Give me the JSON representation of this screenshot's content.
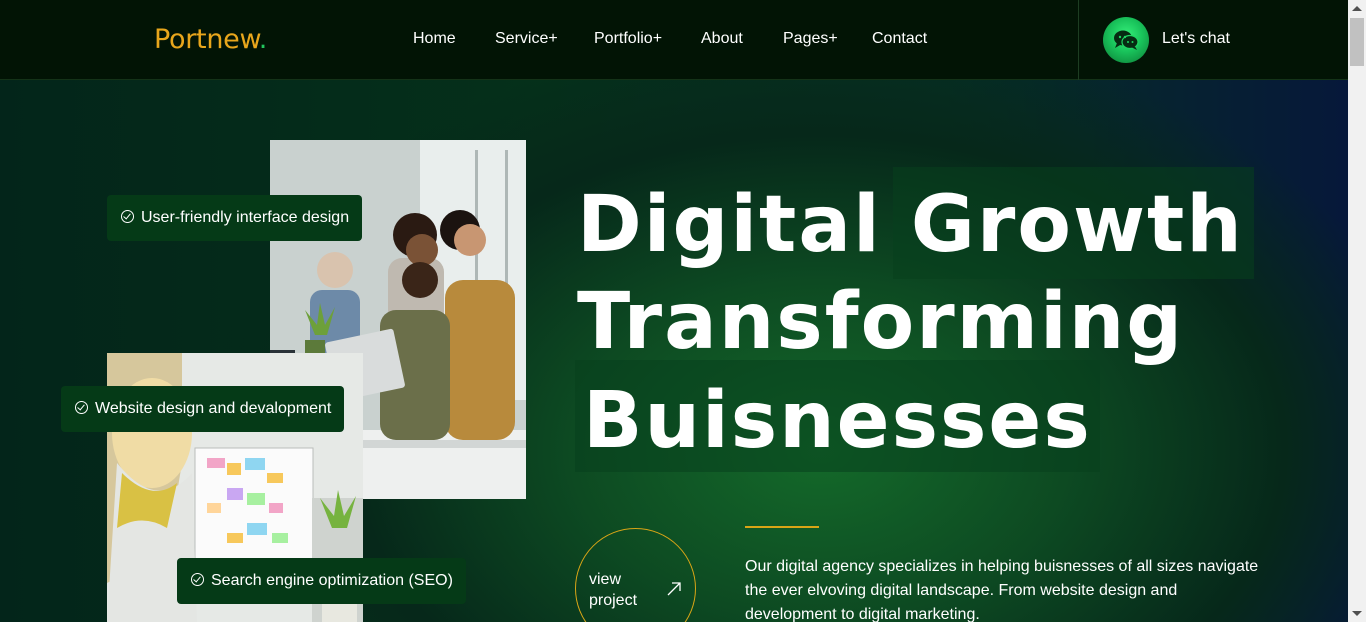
{
  "header": {
    "logo_main": "Portnew",
    "logo_dot": ".",
    "nav": [
      {
        "label": "Home"
      },
      {
        "label": "Service+"
      },
      {
        "label": "Portfolio+"
      },
      {
        "label": "About"
      },
      {
        "label": "Pages+"
      },
      {
        "label": "Contact"
      }
    ],
    "chat_label": "Let's chat",
    "chat_icon": "chat-bubbles-icon"
  },
  "hero": {
    "headline_lines": [
      "Digital Growth",
      "Transforming",
      "Buisnesses"
    ],
    "badges": [
      {
        "label": "User-friendly interface design",
        "icon": "check-circle-icon"
      },
      {
        "label": "Website design and devalopment",
        "icon": "check-circle-icon"
      },
      {
        "label": "Search engine optimization (SEO)",
        "icon": "check-circle-icon"
      }
    ],
    "cta": {
      "line1": "view",
      "line2": "project",
      "icon": "arrow-up-right-icon"
    },
    "description": "Our digital agency specializes in helping buisnesses of all sizes navigate the ever elvoving digital landscape. From website design and development to digital marketing."
  },
  "colors": {
    "logo": "#e8a61c",
    "accent_gold": "#d9a516",
    "accent_green": "#22c55e",
    "badge_bg": "#053a17",
    "header_bg": "#021405"
  }
}
